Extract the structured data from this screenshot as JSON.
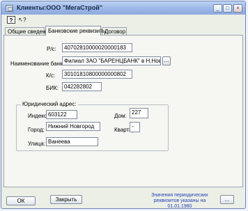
{
  "window": {
    "title": "Клиенты:ООО \"МегаСтрой\"",
    "controls": {
      "minimize": "_",
      "maximize": "□",
      "close": "×"
    }
  },
  "toolbar": {
    "help": "?",
    "whats_this": "↖?"
  },
  "tabs": [
    {
      "label": "Общие сведения",
      "active": false
    },
    {
      "label": "Банковские реквизиты",
      "active": true
    },
    {
      "label": "Договор",
      "active": false
    }
  ],
  "bank": {
    "rs_label": "Р/с:",
    "rs_value": "40702810000020000183",
    "name_label": "Наименование банка:",
    "name_value": "Филиал ЗАО \"БАРЕНЦБАНК\" в Н.Новгороде",
    "name_button": "...",
    "ks_label": "К/с:",
    "ks_value": "30101810800000000802",
    "bik_label": "БИК:",
    "bik_value": "042282802"
  },
  "address": {
    "group_title": "Юридический адрес:",
    "index_label": "Индекс:",
    "index_value": "603122",
    "house_label": "Дом:",
    "house_value": "227",
    "city_label": "Город:",
    "city_value": "Нижний Новгород",
    "apt_label": "Квартира:",
    "apt_value": "-",
    "street_label": "Улица:",
    "street_value": "Ванеева"
  },
  "footer": {
    "ok": "ОК",
    "close": "Закрыть",
    "status_line1": "Значения периодических",
    "status_line2": "реквизитов указаны на 01.01.1980",
    "status_button": "..."
  },
  "colors": {
    "accent": "#2341b7",
    "titlebar": "#9ab7e7"
  }
}
